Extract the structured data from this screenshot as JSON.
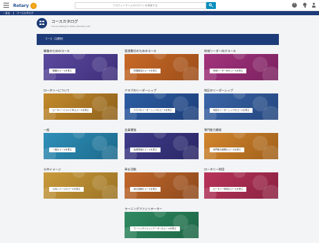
{
  "header": {
    "brand": "Rotary",
    "search_placeholder": "アカウントチームやログインを検索する"
  },
  "breadcrumb": {
    "back": "戻る",
    "current": "コースカタログ"
  },
  "catalog": {
    "title": "コースカタログ",
    "subtitle": "Course Catalog for Rotary Members Left"
  },
  "section": {
    "title": "コース（主題別）"
  },
  "courses": [
    {
      "title": "職業のためのコース",
      "button": "職業のコースを見る",
      "color": "#5b4a9e",
      "color2": "#3e2f7a"
    },
    {
      "title": "管理責任のためのコース",
      "button": "管理責任のコースを見る",
      "color": "#c86a28",
      "color2": "#9c4e1a"
    },
    {
      "title": "地域リーダー向けコース",
      "button": "地域リーダー向けコースを見る",
      "color": "#a3347c",
      "color2": "#7a2260"
    },
    {
      "title": "ロータリーについて",
      "button": "ロータリーについて学ぶコースを見る",
      "color": "#c28a2c",
      "color2": "#8f621c"
    },
    {
      "title": "クラブのリーダーシップ",
      "button": "クラブのリーダーシップのコースを見る",
      "color": "#2d5da3",
      "color2": "#1d3f7a"
    },
    {
      "title": "地区のリーダーシップ",
      "button": "地区のリーダーシップのコースを見る",
      "color": "#3a66a8",
      "color2": "#24467e"
    },
    {
      "title": "一般",
      "button": "一般のコースを見る",
      "color": "#2f8fb8",
      "color2": "#1d6a8c"
    },
    {
      "title": "会員増強",
      "button": "会員増強のコースを見る",
      "color": "#3f3c8a",
      "color2": "#2a2766"
    },
    {
      "title": "専門能力開発",
      "button": "専門能力開発のコースを見る",
      "color": "#d1852e",
      "color2": "#a0601a"
    },
    {
      "title": "公共イメージ",
      "button": "公共イメージのコースを見る",
      "color": "#c99a3c",
      "color2": "#9c7424"
    },
    {
      "title": "奉仕活動",
      "button": "奉仕活動のコースを見る",
      "color": "#c0682c",
      "color2": "#8e4a1c"
    },
    {
      "title": "ロータリー財団",
      "button": "ロータリー財団のコースを見る",
      "color": "#b8345a",
      "color2": "#8a2242"
    },
    {
      "title": "ラーニングファシリテーター",
      "button": "ラーニングファシリテーターのコースを見る",
      "color": "#2f8a62",
      "color2": "#1d6646"
    }
  ]
}
